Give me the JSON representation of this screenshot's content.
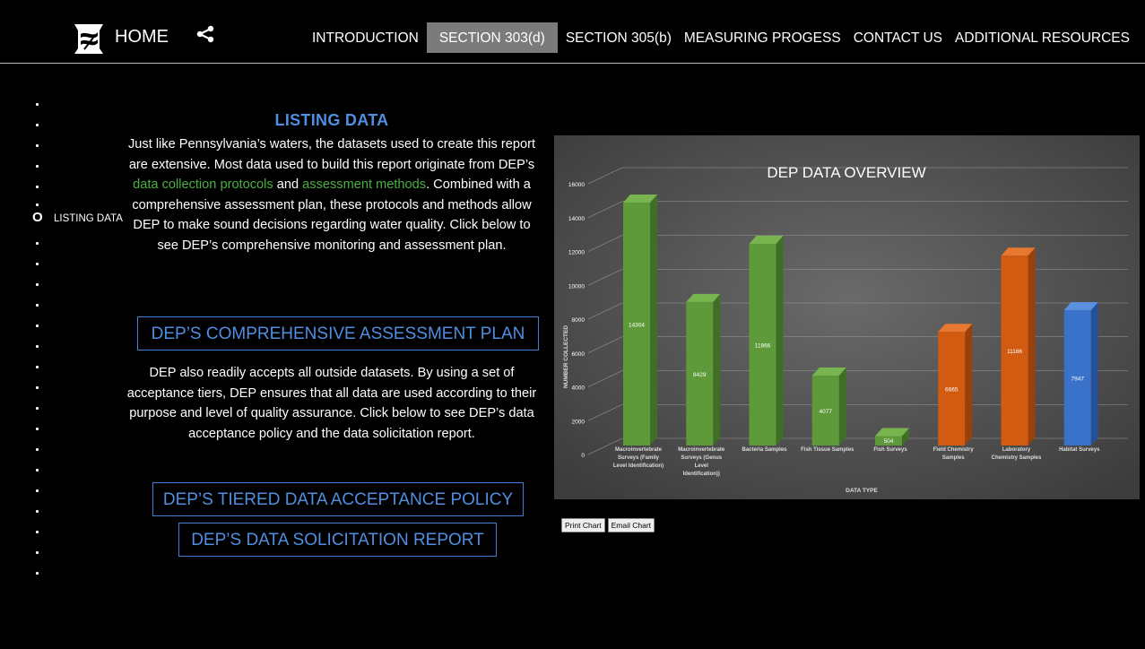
{
  "nav": {
    "home_label": "HOME",
    "items": [
      {
        "label": "INTRODUCTION",
        "active": false
      },
      {
        "label": "SECTION 303(d)",
        "active": true
      },
      {
        "label": "SECTION 305(b)",
        "active": false
      },
      {
        "label": "MEASURING PROGESS",
        "active": false
      },
      {
        "label": "CONTACT US",
        "active": false
      },
      {
        "label": "ADDITIONAL RESOURCES",
        "active": false
      }
    ]
  },
  "rail": {
    "current_marker": "O",
    "current_label": "LISTING DATA"
  },
  "content": {
    "title": "LISTING DATA",
    "para1_a": "Just like Pennsylvania’s waters, the datasets used to create this report are extensive. Most data used to build this report originate from DEP’s ",
    "para1_link1": "data collection protocols",
    "para1_b": " and ",
    "para1_link2": "assessment methods",
    "para1_c": ". Combined with a comprehensive assessment plan, these protocols and methods allow DEP to make sound decisions regarding water quality. Click below to see DEP’s comprehensive monitoring and assessment plan.",
    "button_assessment_plan": "DEP’S COMPREHENSIVE ASSESSMENT PLAN",
    "para2": "DEP also readily accepts all outside datasets. By using a set of acceptance tiers, DEP ensures that all data are used according to their purpose and level of quality assurance. Click below to see DEP’s data acceptance policy and the data solicitation report.",
    "button_acceptance_policy": "DEP’S TIERED DATA ACCEPTANCE POLICY",
    "button_solicitation_report": "DEP’S DATA SOLICITATION REPORT"
  },
  "chart_actions": {
    "print_label": "Print Chart",
    "email_label": "Email Chart"
  },
  "colors": {
    "accent_blue": "#4f8ee1",
    "link_green": "#4db043",
    "bar_green": "#5e9a3a",
    "bar_orange": "#d25b12",
    "bar_blue": "#3a72c9"
  },
  "chart_data": {
    "type": "bar",
    "title": "DEP DATA OVERVIEW",
    "xlabel": "DATA TYPE",
    "ylabel": "NUMBER COLLECTED",
    "ylim": [
      0,
      16000
    ],
    "yticks": [
      0,
      2000,
      4000,
      6000,
      8000,
      10000,
      12000,
      14000,
      16000
    ],
    "grid": true,
    "categories": [
      [
        "Macroinvertebrate",
        "Surveys (Family",
        "Level Identification)"
      ],
      [
        "Macroinvertebrate",
        "Surveys (Genus",
        "Level",
        "Identification))"
      ],
      [
        "Bacteria Samples"
      ],
      [
        "Fish Tissue Samples"
      ],
      [
        "Fish Surveys"
      ],
      [
        "Field Chemistry",
        "Samples"
      ],
      [
        "Laboratory",
        "Chemistry Samples"
      ],
      [
        "Habitat Surveys"
      ]
    ],
    "values": [
      14304,
      8429,
      11866,
      4077,
      504,
      6665,
      11166,
      7947
    ],
    "bar_colors": [
      "green",
      "green",
      "green",
      "green",
      "green",
      "orange",
      "orange",
      "blue"
    ]
  }
}
